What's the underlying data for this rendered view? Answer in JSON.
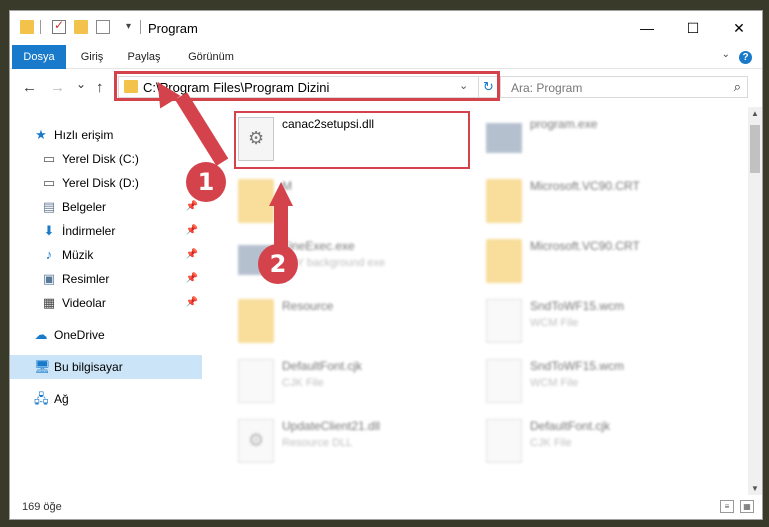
{
  "window": {
    "title": "Program",
    "minimize": "—",
    "maximize": "☐",
    "close": "✕"
  },
  "ribbon": {
    "tabs": [
      "Dosya",
      "Giriş",
      "Paylaş",
      "Görünüm"
    ],
    "help": "?"
  },
  "nav": {
    "back": "←",
    "forward": "→",
    "recent": "⌄",
    "up": "↑",
    "address": "C:\\Program Files\\Program Dizini",
    "search_placeholder": "Ara: Program"
  },
  "sidebar": {
    "items": [
      {
        "label": "Hızlı erişim",
        "icon": "star-icon"
      },
      {
        "label": "Yerel Disk (C:)",
        "icon": "drive-icon"
      },
      {
        "label": "Yerel Disk (D:)",
        "icon": "drive-icon"
      },
      {
        "label": "Belgeler",
        "icon": "documents-icon"
      },
      {
        "label": "İndirmeler",
        "icon": "download-icon"
      },
      {
        "label": "Müzik",
        "icon": "music-icon"
      },
      {
        "label": "Resimler",
        "icon": "pictures-icon"
      },
      {
        "label": "Videolar",
        "icon": "videos-icon"
      },
      {
        "label": "OneDrive",
        "icon": "cloud-icon"
      },
      {
        "label": "Bu bilgisayar",
        "icon": "computer-icon"
      },
      {
        "label": "Ağ",
        "icon": "network-icon"
      }
    ]
  },
  "files": [
    {
      "name": "canac2setupsi.dll",
      "type": ""
    },
    {
      "name": "program.exe",
      "type": ""
    },
    {
      "name": "M",
      "type": ""
    },
    {
      "name": "Microsoft.VC90.CRT",
      "type": ""
    },
    {
      "name": "FineExec.exe",
      "type": "BBY background exe"
    },
    {
      "name": "Microsoft.VC90.CRT",
      "type": ""
    },
    {
      "name": "Resource",
      "type": ""
    },
    {
      "name": "SndToWF15.wcm",
      "type": "WCM File"
    },
    {
      "name": "DefaultFont.cjk",
      "type": "CJK File"
    },
    {
      "name": "SndToWF15.wcm",
      "type": "WCM File"
    },
    {
      "name": "UpdateClient21.dll",
      "type": "Resource DLL"
    },
    {
      "name": "DefaultFont.cjk",
      "type": "CJK File"
    }
  ],
  "status": {
    "count": "169 öğe"
  },
  "annotations": {
    "step1": "1",
    "step2": "2",
    "color": "#d4424b"
  }
}
